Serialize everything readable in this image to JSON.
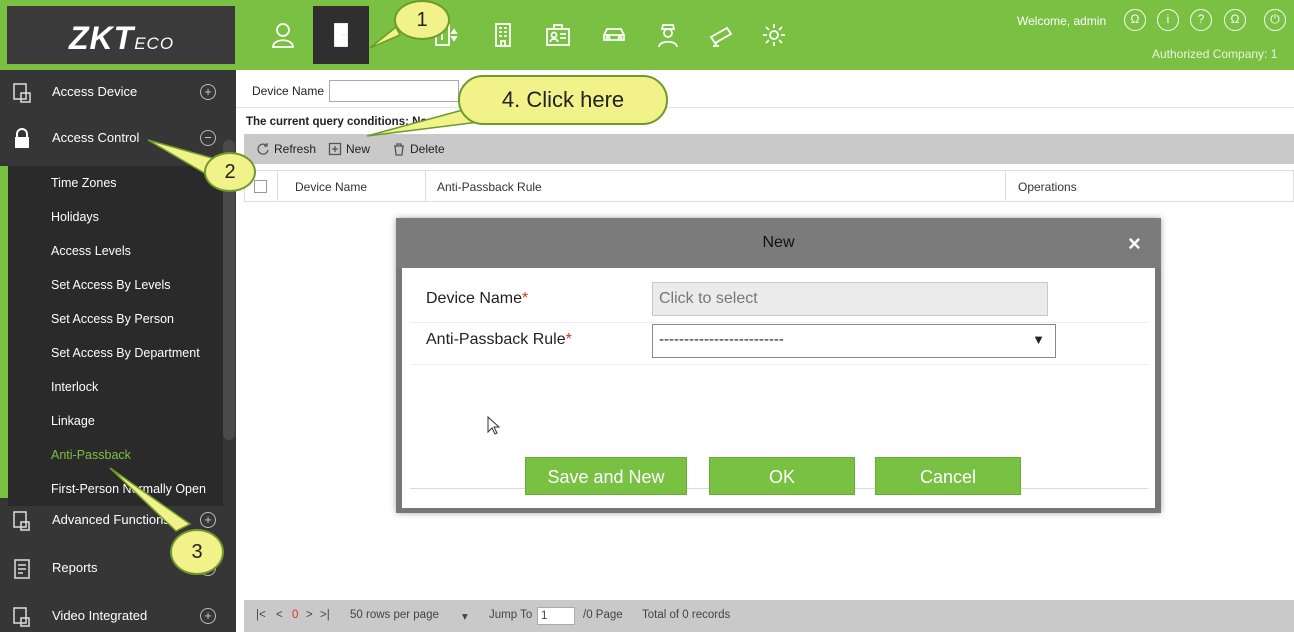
{
  "header": {
    "logo_main": "ZKT",
    "logo_sub": "ECO",
    "nav_icons": [
      "person-icon",
      "door-icon",
      "elevator-icon",
      "building-icon",
      "visitor-card-icon",
      "car-icon",
      "guard-icon",
      "camera-icon",
      "gear-icon"
    ],
    "welcome": "Welcome, admin",
    "company": "Authorized Company: 1",
    "right_icons": [
      "user-circle-icon",
      "info-icon",
      "help-icon",
      "account-icon",
      "power-icon"
    ]
  },
  "sidebar": {
    "sections": [
      {
        "label": "Access Device",
        "toggle": "+",
        "icon": "device-icon"
      },
      {
        "label": "Access Control",
        "toggle": "−",
        "icon": "lock-icon"
      },
      {
        "label": "Advanced Functions",
        "toggle": "+",
        "icon": "advanced-icon"
      },
      {
        "label": "Reports",
        "toggle": "+",
        "icon": "report-icon"
      },
      {
        "label": "Video Integrated",
        "toggle": "+",
        "icon": "video-icon"
      }
    ],
    "items": [
      {
        "label": "Time Zones"
      },
      {
        "label": "Holidays"
      },
      {
        "label": "Access Levels"
      },
      {
        "label": "Set Access By Levels"
      },
      {
        "label": "Set Access By Person"
      },
      {
        "label": "Set Access By Department"
      },
      {
        "label": "Interlock"
      },
      {
        "label": "Linkage"
      },
      {
        "label": "Anti-Passback"
      },
      {
        "label": "First-Person Normally Open"
      }
    ],
    "active_item": "Anti-Passback"
  },
  "main": {
    "filter_label": "Device Name",
    "filter_value": "",
    "query_note": "The current query conditions: None",
    "toolbar": {
      "refresh": "Refresh",
      "new": "New",
      "delete": "Delete"
    },
    "columns": [
      "Device Name",
      "Anti-Passback Rule",
      "Operations"
    ],
    "pager": {
      "rows_per_page": "50 rows per page",
      "current_page": "0",
      "jump_to_label": "Jump To",
      "jump_value": "1",
      "page_total": "/0 Page",
      "records": "Total of 0 records"
    }
  },
  "modal": {
    "title": "New",
    "close": "×",
    "fields": [
      {
        "label": "Device Name",
        "value": "Click to select"
      },
      {
        "label": "Anti-Passback Rule",
        "value": "-------------------------"
      }
    ],
    "buttons": {
      "save_new": "Save and New",
      "ok": "OK",
      "cancel": "Cancel"
    }
  },
  "callouts": {
    "step1": "1",
    "step2": "2",
    "step3": "3",
    "step4": "4. Click here"
  },
  "colors": {
    "brand_green": "#7ac143",
    "sidebar_dark": "#363636",
    "callout_yellow": "#f2f28a"
  }
}
